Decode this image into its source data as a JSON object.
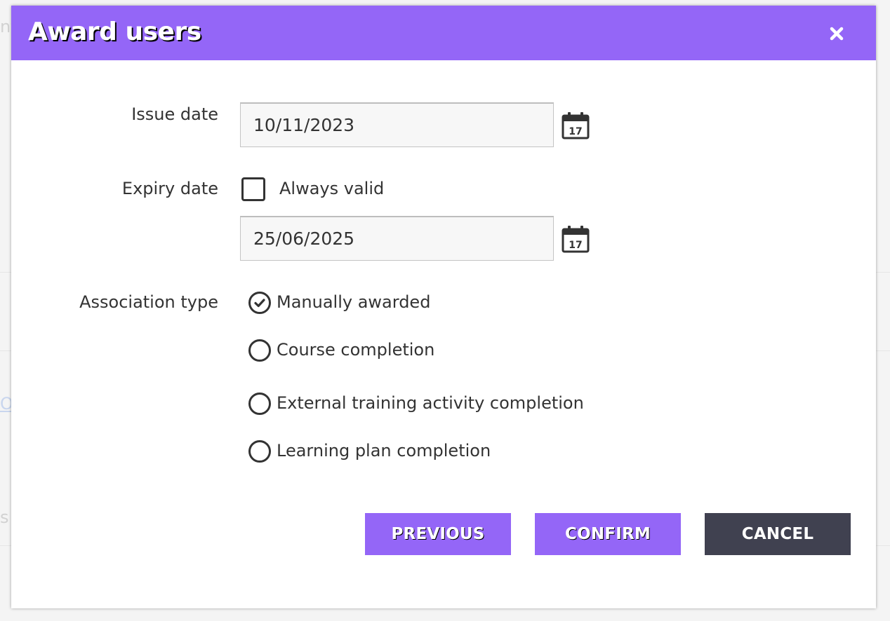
{
  "dialog": {
    "title": "Award users",
    "close_icon": "close-icon"
  },
  "form": {
    "issue_date": {
      "label": "Issue date",
      "value": "10/11/2023",
      "icon": "calendar-icon"
    },
    "expiry_date": {
      "label": "Expiry date",
      "always_valid_label": "Always valid",
      "always_valid_checked": false,
      "value": "25/06/2025",
      "icon": "calendar-icon"
    },
    "association_type": {
      "label": "Association type",
      "selected": "Manually awarded",
      "options": [
        "Manually awarded",
        "Course completion",
        "External training activity completion",
        "Learning plan completion"
      ]
    }
  },
  "buttons": {
    "previous": "PREVIOUS",
    "confirm": "CONFIRM",
    "cancel": "CANCEL"
  },
  "colors": {
    "accent": "#9466f7",
    "dark_button": "#404150",
    "text": "#333333",
    "input_bg": "#f7f7f7"
  },
  "background_fragments": [
    "nt",
    "O",
    "s"
  ]
}
